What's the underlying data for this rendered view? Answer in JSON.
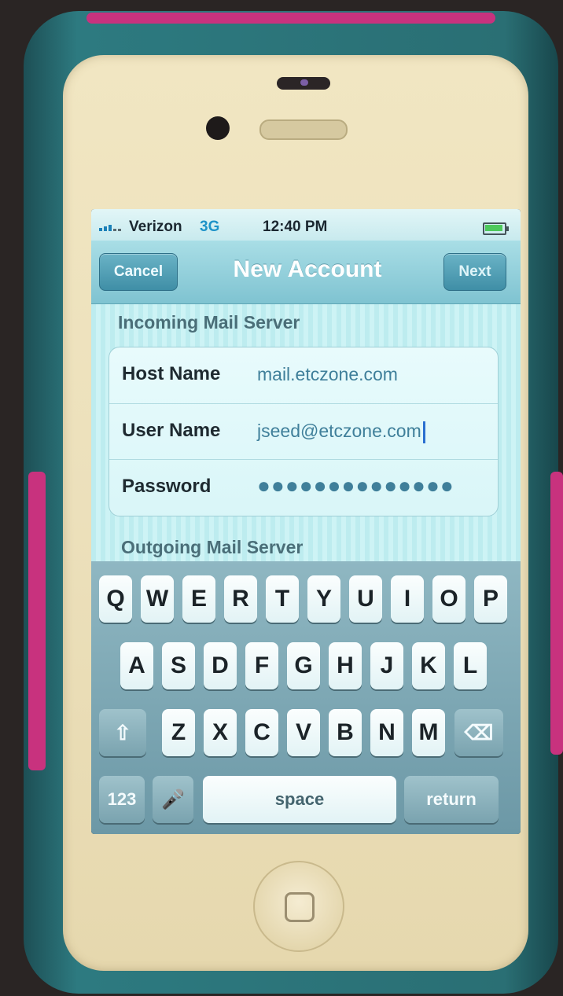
{
  "status_bar": {
    "carrier": "Verizon",
    "network": "3G",
    "time": "12:40 PM",
    "battery_icon": "battery-icon",
    "signal_icon": "signal-bars-icon"
  },
  "nav": {
    "cancel_label": "Cancel",
    "title": "New Account",
    "next_label": "Next"
  },
  "incoming": {
    "header": "Incoming Mail Server",
    "fields": [
      {
        "label": "Host Name",
        "value": "mail.etczone.com"
      },
      {
        "label": "User Name",
        "value": "jseed@etczone.com"
      },
      {
        "label": "Password",
        "value": "●●●●●●●●●●●●●●"
      }
    ]
  },
  "outgoing": {
    "header": "Outgoing Mail Server"
  },
  "keyboard": {
    "row1": [
      "Q",
      "W",
      "E",
      "R",
      "T",
      "Y",
      "U",
      "I",
      "O",
      "P"
    ],
    "row2": [
      "A",
      "S",
      "D",
      "F",
      "G",
      "H",
      "J",
      "K",
      "L"
    ],
    "row3": [
      "Z",
      "X",
      "C",
      "V",
      "B",
      "N",
      "M"
    ],
    "shift_icon": "shift-icon",
    "delete_icon": "delete-icon",
    "numbers_label": "123",
    "mic_icon": "microphone-icon",
    "space_label": "space",
    "return_label": "return"
  },
  "colors": {
    "nav_bar": "#7fc3d1",
    "accent": "#1e93c8",
    "case_teal": "#2a6f74",
    "case_pink": "#c8327e"
  }
}
